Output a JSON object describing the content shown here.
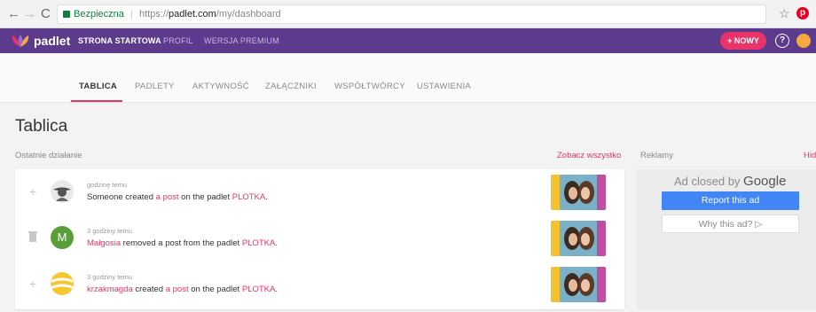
{
  "browser": {
    "secure_label": "Bezpieczna",
    "url_scheme": "https://",
    "url_host": "padlet.com",
    "url_path": "/my/dashboard"
  },
  "appbar": {
    "logo_text": "padlet",
    "nav": [
      {
        "label": "STRONA STARTOWA",
        "active": true
      },
      {
        "label": "PROFIL",
        "active": false
      },
      {
        "label": "WERSJA PREMIUM",
        "active": false
      }
    ],
    "new_button": "+ NOWY",
    "help_icon": "?"
  },
  "tabs": [
    {
      "label": "TABLICA",
      "active": true
    },
    {
      "label": "PADLETY"
    },
    {
      "label": "AKTYWNOŚĆ"
    },
    {
      "label": "ZAŁĄCZNIKI"
    },
    {
      "label": "WSPÓŁTWÓRCY"
    },
    {
      "label": "USTAWIENIA"
    }
  ],
  "main": {
    "title": "Tablica",
    "section_label": "Ostatnie działanie",
    "see_all": "Zobacz wszystko",
    "ads_label": "Reklamy",
    "hide_label": "Hid"
  },
  "activity": [
    {
      "action_icon": "+",
      "time": "godzinę temu",
      "actor": "Someone",
      "verb": " created ",
      "object": "a post",
      "middle": " on the padlet ",
      "padlet": "PLOTKA",
      "end": "."
    },
    {
      "action_icon": "trash",
      "avatar_letter": "M",
      "time": "3 godziny temu",
      "actor": "Małgosia",
      "verb": " removed a post from the padlet ",
      "object": "",
      "middle": "",
      "padlet": "PLOTKA",
      "end": "."
    },
    {
      "action_icon": "+",
      "time": "3 godziny temu",
      "actor": "krzakmagda",
      "verb": " created ",
      "object": "a post",
      "middle": " on the padlet ",
      "padlet": "PLOTKA",
      "end": "."
    }
  ],
  "ad": {
    "closed_prefix": "Ad closed by ",
    "closed_brand": "Google",
    "report": "Report this ad",
    "why": "Why this ad? ▷"
  },
  "colors": {
    "brand_purple": "#5c3a8c",
    "accent_pink": "#e8336b",
    "ad_blue": "#4285f4"
  }
}
